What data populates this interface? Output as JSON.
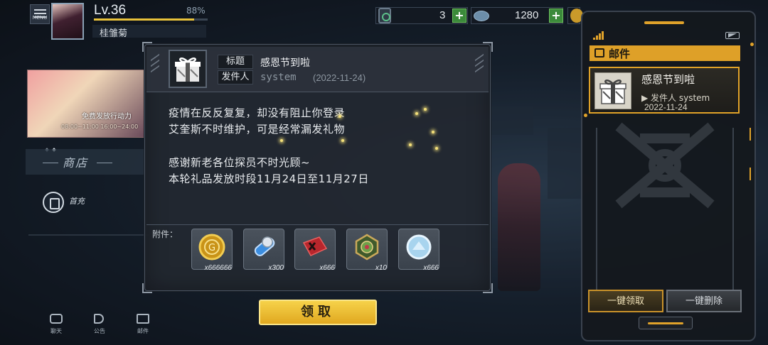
{
  "player": {
    "menu_label": "MENU",
    "level": "Lv.36",
    "exp_percent": "88%",
    "exp_fraction": 0.88,
    "name": "桂雏菊"
  },
  "currencies": [
    {
      "icon": "ticket-icon",
      "value": "3"
    },
    {
      "icon": "cloud-crystal-icon",
      "value": "1280"
    }
  ],
  "sidebar": {
    "banner_text": "免费发放行动力",
    "banner_time": "08:00~11:00   16:00~24:00",
    "shop_label": "商店",
    "recharge_label": "首充"
  },
  "bottom_nav": [
    {
      "label": "聊天",
      "icon": "chat-icon"
    },
    {
      "label": "公告",
      "icon": "announcement-icon"
    },
    {
      "label": "邮件",
      "icon": "mail-icon"
    }
  ],
  "mail_detail": {
    "title_label": "标题",
    "title": "感恩节到啦",
    "sender_label": "发件人",
    "sender": "system",
    "date": "(2022-11-24)",
    "body": [
      "疫情在反反复复，却没有阻止你登录",
      "艾奎斯不时维护，可是经常漏发礼物",
      "感谢新老各位探员不时光顾~",
      "本轮礼品发放时段11月24日至11月27日"
    ],
    "attachments_label": "附件：",
    "attachments": [
      {
        "icon": "gold-coin-icon",
        "qty": "x666666"
      },
      {
        "icon": "blue-capsule-icon",
        "qty": "x300"
      },
      {
        "icon": "red-ticket-icon",
        "qty": "x666"
      },
      {
        "icon": "green-medal-icon",
        "qty": "x10"
      },
      {
        "icon": "crystal-disc-icon",
        "qty": "x666"
      }
    ],
    "claim_label": "领取"
  },
  "mail_panel": {
    "header": "邮件",
    "items": [
      {
        "title": "感恩节到啦",
        "from": "发件人 system",
        "date": "2022-11-24"
      }
    ],
    "claim_all_label": "一键领取",
    "delete_all_label": "一键删除"
  },
  "colors": {
    "accent_gold": "#e0a22a",
    "claim_yellow": "#f6d24a",
    "plus_green": "#3b8a3a"
  }
}
